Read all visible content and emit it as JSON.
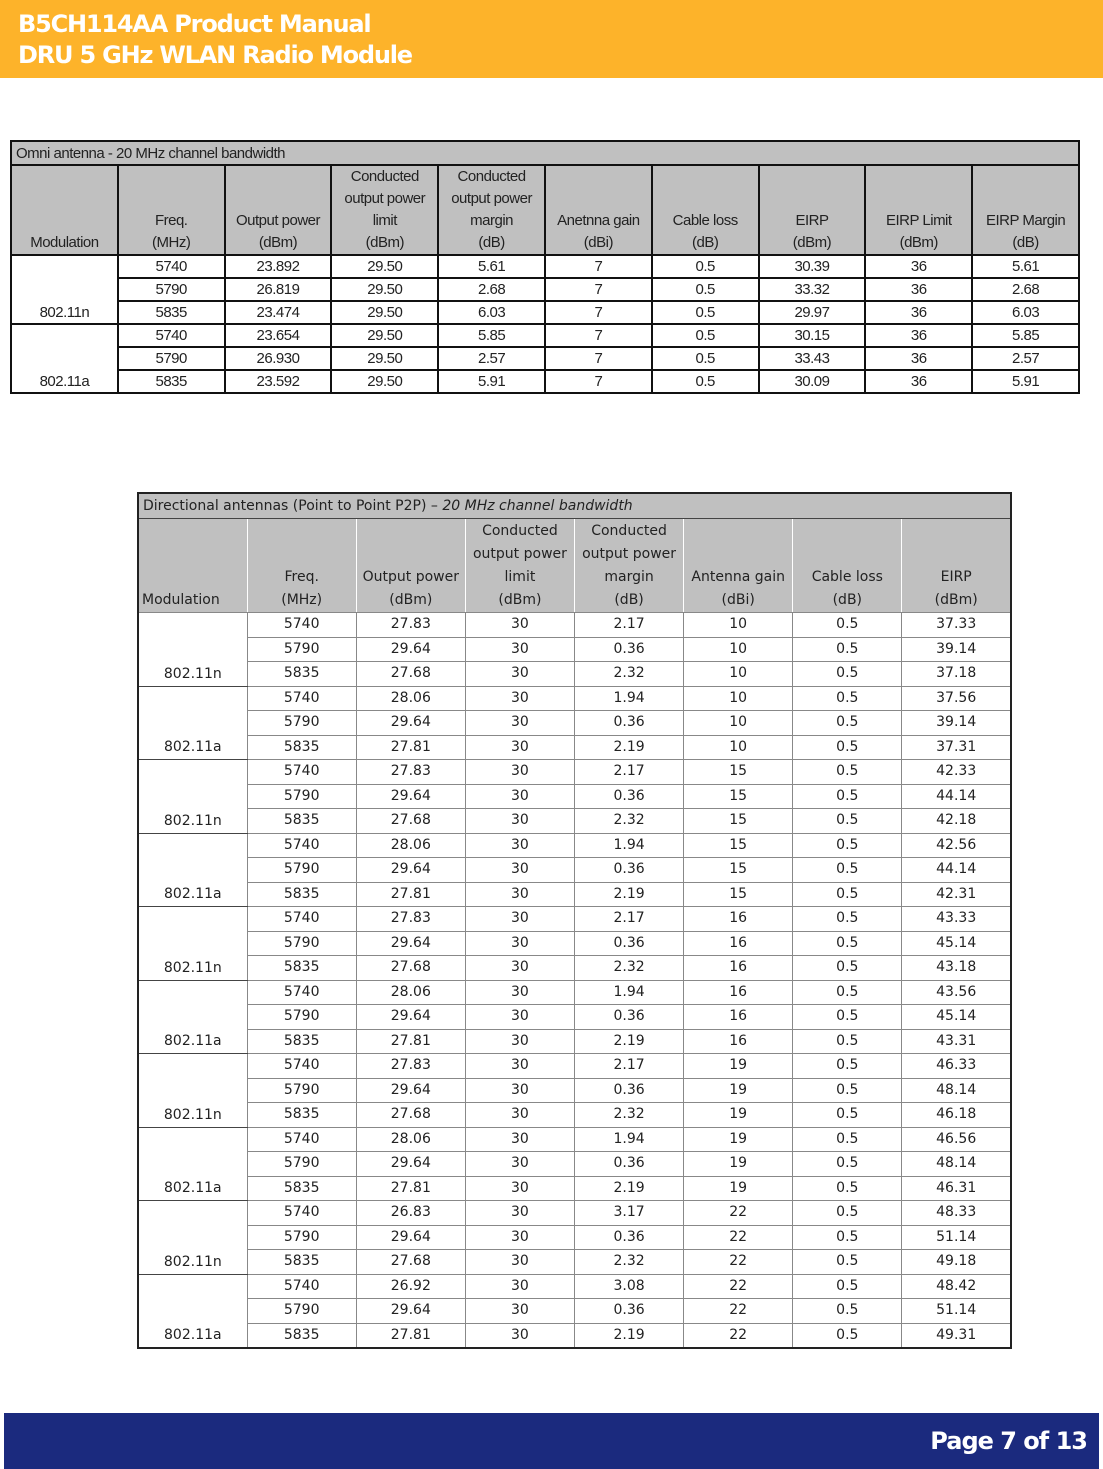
{
  "header": {
    "line1": "B5CH114AA Product Manual",
    "line2": "DRU 5 GHz WLAN Radio Module"
  },
  "footer": {
    "page": "Page 7 of 13"
  },
  "omni_table": {
    "title": "Omni antenna - 20 MHz channel bandwidth",
    "columns": [
      [
        "Modulation"
      ],
      [
        "Freq.",
        "(MHz)"
      ],
      [
        "Output power",
        "(dBm)"
      ],
      [
        "Conducted",
        "output power",
        "limit",
        "(dBm)"
      ],
      [
        "Conducted",
        "output power",
        "margin",
        "(dB)"
      ],
      [
        "Anetnna gain",
        "(dBi)"
      ],
      [
        "Cable loss",
        "(dB)"
      ],
      [
        "EIRP",
        "(dBm)"
      ],
      [
        "EIRP Limit",
        "(dBm)"
      ],
      [
        "EIRP Margin",
        "(dB)"
      ]
    ],
    "groups": [
      {
        "modulation": "802.11n",
        "rows": [
          [
            "5740",
            "23.892",
            "29.50",
            "5.61",
            "7",
            "0.5",
            "30.39",
            "36",
            "5.61"
          ],
          [
            "5790",
            "26.819",
            "29.50",
            "2.68",
            "7",
            "0.5",
            "33.32",
            "36",
            "2.68"
          ],
          [
            "5835",
            "23.474",
            "29.50",
            "6.03",
            "7",
            "0.5",
            "29.97",
            "36",
            "6.03"
          ]
        ]
      },
      {
        "modulation": "802.11a",
        "rows": [
          [
            "5740",
            "23.654",
            "29.50",
            "5.85",
            "7",
            "0.5",
            "30.15",
            "36",
            "5.85"
          ],
          [
            "5790",
            "26.930",
            "29.50",
            "2.57",
            "7",
            "0.5",
            "33.43",
            "36",
            "2.57"
          ],
          [
            "5835",
            "23.592",
            "29.50",
            "5.91",
            "7",
            "0.5",
            "30.09",
            "36",
            "5.91"
          ]
        ]
      }
    ]
  },
  "directional_table": {
    "title_plain": "Directional antennas (Point to Point P2P) – ",
    "title_italic": "20 MHz channel bandwidth",
    "columns": [
      [
        "Modulation"
      ],
      [
        "Freq.",
        "(MHz)"
      ],
      [
        "Output power",
        "(dBm)"
      ],
      [
        "Conducted",
        "output power",
        "limit",
        "(dBm)"
      ],
      [
        "Conducted",
        "output power",
        "margin",
        "(dB)"
      ],
      [
        "Antenna gain",
        "(dBi)"
      ],
      [
        "Cable loss",
        "(dB)"
      ],
      [
        "EIRP",
        "(dBm)"
      ]
    ],
    "groups": [
      {
        "modulation": "802.11n",
        "rows": [
          [
            "5740",
            "27.83",
            "30",
            "2.17",
            "10",
            "0.5",
            "37.33"
          ],
          [
            "5790",
            "29.64",
            "30",
            "0.36",
            "10",
            "0.5",
            "39.14"
          ],
          [
            "5835",
            "27.68",
            "30",
            "2.32",
            "10",
            "0.5",
            "37.18"
          ]
        ]
      },
      {
        "modulation": "802.11a",
        "rows": [
          [
            "5740",
            "28.06",
            "30",
            "1.94",
            "10",
            "0.5",
            "37.56"
          ],
          [
            "5790",
            "29.64",
            "30",
            "0.36",
            "10",
            "0.5",
            "39.14"
          ],
          [
            "5835",
            "27.81",
            "30",
            "2.19",
            "10",
            "0.5",
            "37.31"
          ]
        ]
      },
      {
        "modulation": "802.11n",
        "rows": [
          [
            "5740",
            "27.83",
            "30",
            "2.17",
            "15",
            "0.5",
            "42.33"
          ],
          [
            "5790",
            "29.64",
            "30",
            "0.36",
            "15",
            "0.5",
            "44.14"
          ],
          [
            "5835",
            "27.68",
            "30",
            "2.32",
            "15",
            "0.5",
            "42.18"
          ]
        ]
      },
      {
        "modulation": "802.11a",
        "rows": [
          [
            "5740",
            "28.06",
            "30",
            "1.94",
            "15",
            "0.5",
            "42.56"
          ],
          [
            "5790",
            "29.64",
            "30",
            "0.36",
            "15",
            "0.5",
            "44.14"
          ],
          [
            "5835",
            "27.81",
            "30",
            "2.19",
            "15",
            "0.5",
            "42.31"
          ]
        ]
      },
      {
        "modulation": "802.11n",
        "rows": [
          [
            "5740",
            "27.83",
            "30",
            "2.17",
            "16",
            "0.5",
            "43.33"
          ],
          [
            "5790",
            "29.64",
            "30",
            "0.36",
            "16",
            "0.5",
            "45.14"
          ],
          [
            "5835",
            "27.68",
            "30",
            "2.32",
            "16",
            "0.5",
            "43.18"
          ]
        ]
      },
      {
        "modulation": "802.11a",
        "rows": [
          [
            "5740",
            "28.06",
            "30",
            "1.94",
            "16",
            "0.5",
            "43.56"
          ],
          [
            "5790",
            "29.64",
            "30",
            "0.36",
            "16",
            "0.5",
            "45.14"
          ],
          [
            "5835",
            "27.81",
            "30",
            "2.19",
            "16",
            "0.5",
            "43.31"
          ]
        ]
      },
      {
        "modulation": "802.11n",
        "rows": [
          [
            "5740",
            "27.83",
            "30",
            "2.17",
            "19",
            "0.5",
            "46.33"
          ],
          [
            "5790",
            "29.64",
            "30",
            "0.36",
            "19",
            "0.5",
            "48.14"
          ],
          [
            "5835",
            "27.68",
            "30",
            "2.32",
            "19",
            "0.5",
            "46.18"
          ]
        ]
      },
      {
        "modulation": "802.11a",
        "rows": [
          [
            "5740",
            "28.06",
            "30",
            "1.94",
            "19",
            "0.5",
            "46.56"
          ],
          [
            "5790",
            "29.64",
            "30",
            "0.36",
            "19",
            "0.5",
            "48.14"
          ],
          [
            "5835",
            "27.81",
            "30",
            "2.19",
            "19",
            "0.5",
            "46.31"
          ]
        ]
      },
      {
        "modulation": "802.11n",
        "rows": [
          [
            "5740",
            "26.83",
            "30",
            "3.17",
            "22",
            "0.5",
            "48.33"
          ],
          [
            "5790",
            "29.64",
            "30",
            "0.36",
            "22",
            "0.5",
            "51.14"
          ],
          [
            "5835",
            "27.68",
            "30",
            "2.32",
            "22",
            "0.5",
            "49.18"
          ]
        ]
      },
      {
        "modulation": "802.11a",
        "rows": [
          [
            "5740",
            "26.92",
            "30",
            "3.08",
            "22",
            "0.5",
            "48.42"
          ],
          [
            "5790",
            "29.64",
            "30",
            "0.36",
            "22",
            "0.5",
            "51.14"
          ],
          [
            "5835",
            "27.81",
            "30",
            "2.19",
            "22",
            "0.5",
            "49.31"
          ]
        ]
      }
    ]
  }
}
